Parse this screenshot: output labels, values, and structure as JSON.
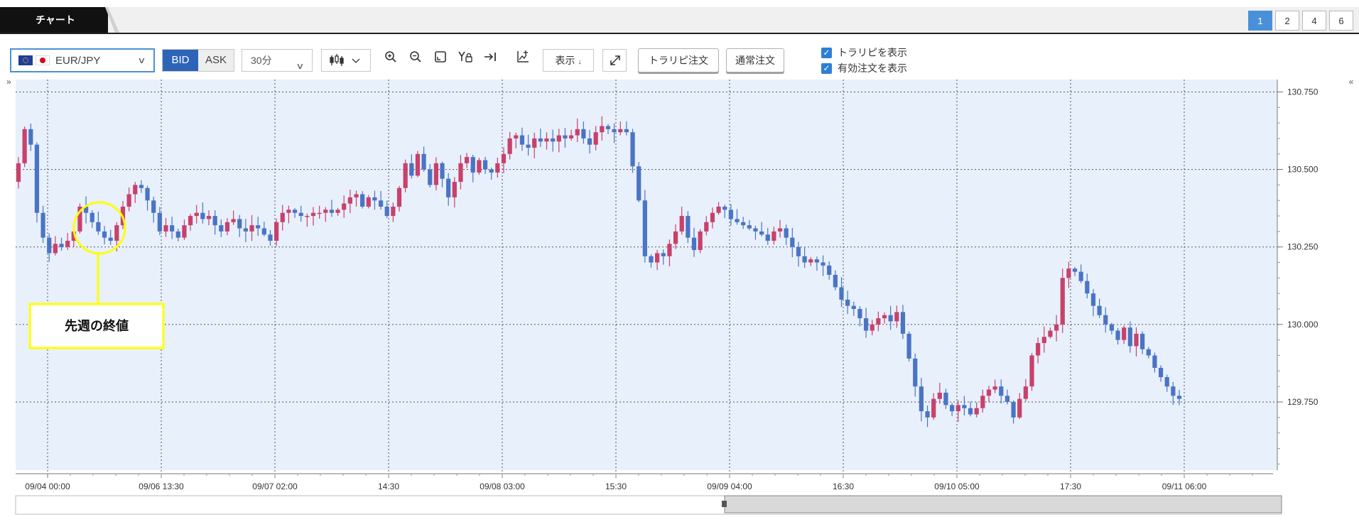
{
  "panel": {
    "title": "チャート",
    "layout_buttons": [
      "1",
      "2",
      "4",
      "6"
    ],
    "active_layout": "1"
  },
  "toolbar": {
    "symbol": "EUR/JPY",
    "bid_label": "BID",
    "ask_label": "ASK",
    "timeframe": "30分",
    "display_label": "表示",
    "trail_order_label": "トラリピ注文",
    "normal_order_label": "通常注文",
    "show_trail_label": "トラリピを表示",
    "show_valid_orders_label": "有効注文を表示",
    "show_trail_checked": true,
    "show_valid_orders_checked": true
  },
  "annotation": {
    "label": "先週の終値",
    "color": "#ffff00"
  },
  "colors": {
    "up": "#c8416a",
    "down": "#4a74c4",
    "plot_bg": "#e8f0fc",
    "grid": "#555555"
  },
  "chart_data": {
    "type": "candlestick",
    "instrument": "EUR/JPY",
    "timeframe": "30分",
    "y_ticks": [
      "130.750",
      "130.500",
      "130.250",
      "130.000",
      "129.750"
    ],
    "y_tick_values": [
      130.75,
      130.5,
      130.25,
      130.0,
      129.75
    ],
    "ylim": [
      129.53,
      130.79
    ],
    "x_ticks": [
      "09/04 00:00",
      "09/06 13:30",
      "09/07 02:00",
      "14:30",
      "09/08 03:00",
      "15:30",
      "09/09 04:00",
      "16:30",
      "09/10 05:00",
      "17:30",
      "09/11 06:00"
    ],
    "grid": true,
    "close_series": [
      130.52,
      130.63,
      130.58,
      130.36,
      130.28,
      130.23,
      130.26,
      130.25,
      130.27,
      130.3,
      130.38,
      130.36,
      130.33,
      130.3,
      130.28,
      130.27,
      130.32,
      130.38,
      130.42,
      130.45,
      130.44,
      130.4,
      130.36,
      130.3,
      130.32,
      130.3,
      130.28,
      130.32,
      130.35,
      130.36,
      130.34,
      130.35,
      130.32,
      130.3,
      130.33,
      130.34,
      130.31,
      130.3,
      130.32,
      130.31,
      130.29,
      130.27,
      130.33,
      130.36,
      130.37,
      130.36,
      130.35,
      130.35,
      130.36,
      130.36,
      130.37,
      130.36,
      130.37,
      130.39,
      130.41,
      130.42,
      130.38,
      130.41,
      130.4,
      130.38,
      130.35,
      130.38,
      130.44,
      130.52,
      130.48,
      130.55,
      130.5,
      130.45,
      130.52,
      130.47,
      130.41,
      130.46,
      130.52,
      130.54,
      130.49,
      130.53,
      130.5,
      130.49,
      130.52,
      130.55,
      130.6,
      130.61,
      130.58,
      130.57,
      130.6,
      130.59,
      130.6,
      130.59,
      130.61,
      130.6,
      130.61,
      130.63,
      130.6,
      130.58,
      130.62,
      130.64,
      130.63,
      130.62,
      130.63,
      130.62,
      130.51,
      130.4,
      130.22,
      130.2,
      130.23,
      130.22,
      130.26,
      130.3,
      130.35,
      130.28,
      130.24,
      130.3,
      130.33,
      130.36,
      130.38,
      130.37,
      130.34,
      130.33,
      130.32,
      130.31,
      130.3,
      130.29,
      130.27,
      130.3,
      130.31,
      130.28,
      130.25,
      130.22,
      130.2,
      130.21,
      130.2,
      130.19,
      130.16,
      130.12,
      130.08,
      130.06,
      130.05,
      130.02,
      129.98,
      130.0,
      130.02,
      130.03,
      130.01,
      130.04,
      129.97,
      129.89,
      129.8,
      129.72,
      129.7,
      129.76,
      129.78,
      129.74,
      129.72,
      129.74,
      129.73,
      129.71,
      129.73,
      129.77,
      129.79,
      129.8,
      129.77,
      129.75,
      129.7,
      129.76,
      129.8,
      129.9,
      129.94,
      129.96,
      129.98,
      130.0,
      130.15,
      130.18,
      130.17,
      130.14,
      130.1,
      130.06,
      130.03,
      130.0,
      129.98,
      129.95,
      129.99,
      129.93,
      129.97,
      129.92,
      129.9,
      129.86,
      129.83,
      129.8,
      129.77,
      129.76
    ]
  }
}
